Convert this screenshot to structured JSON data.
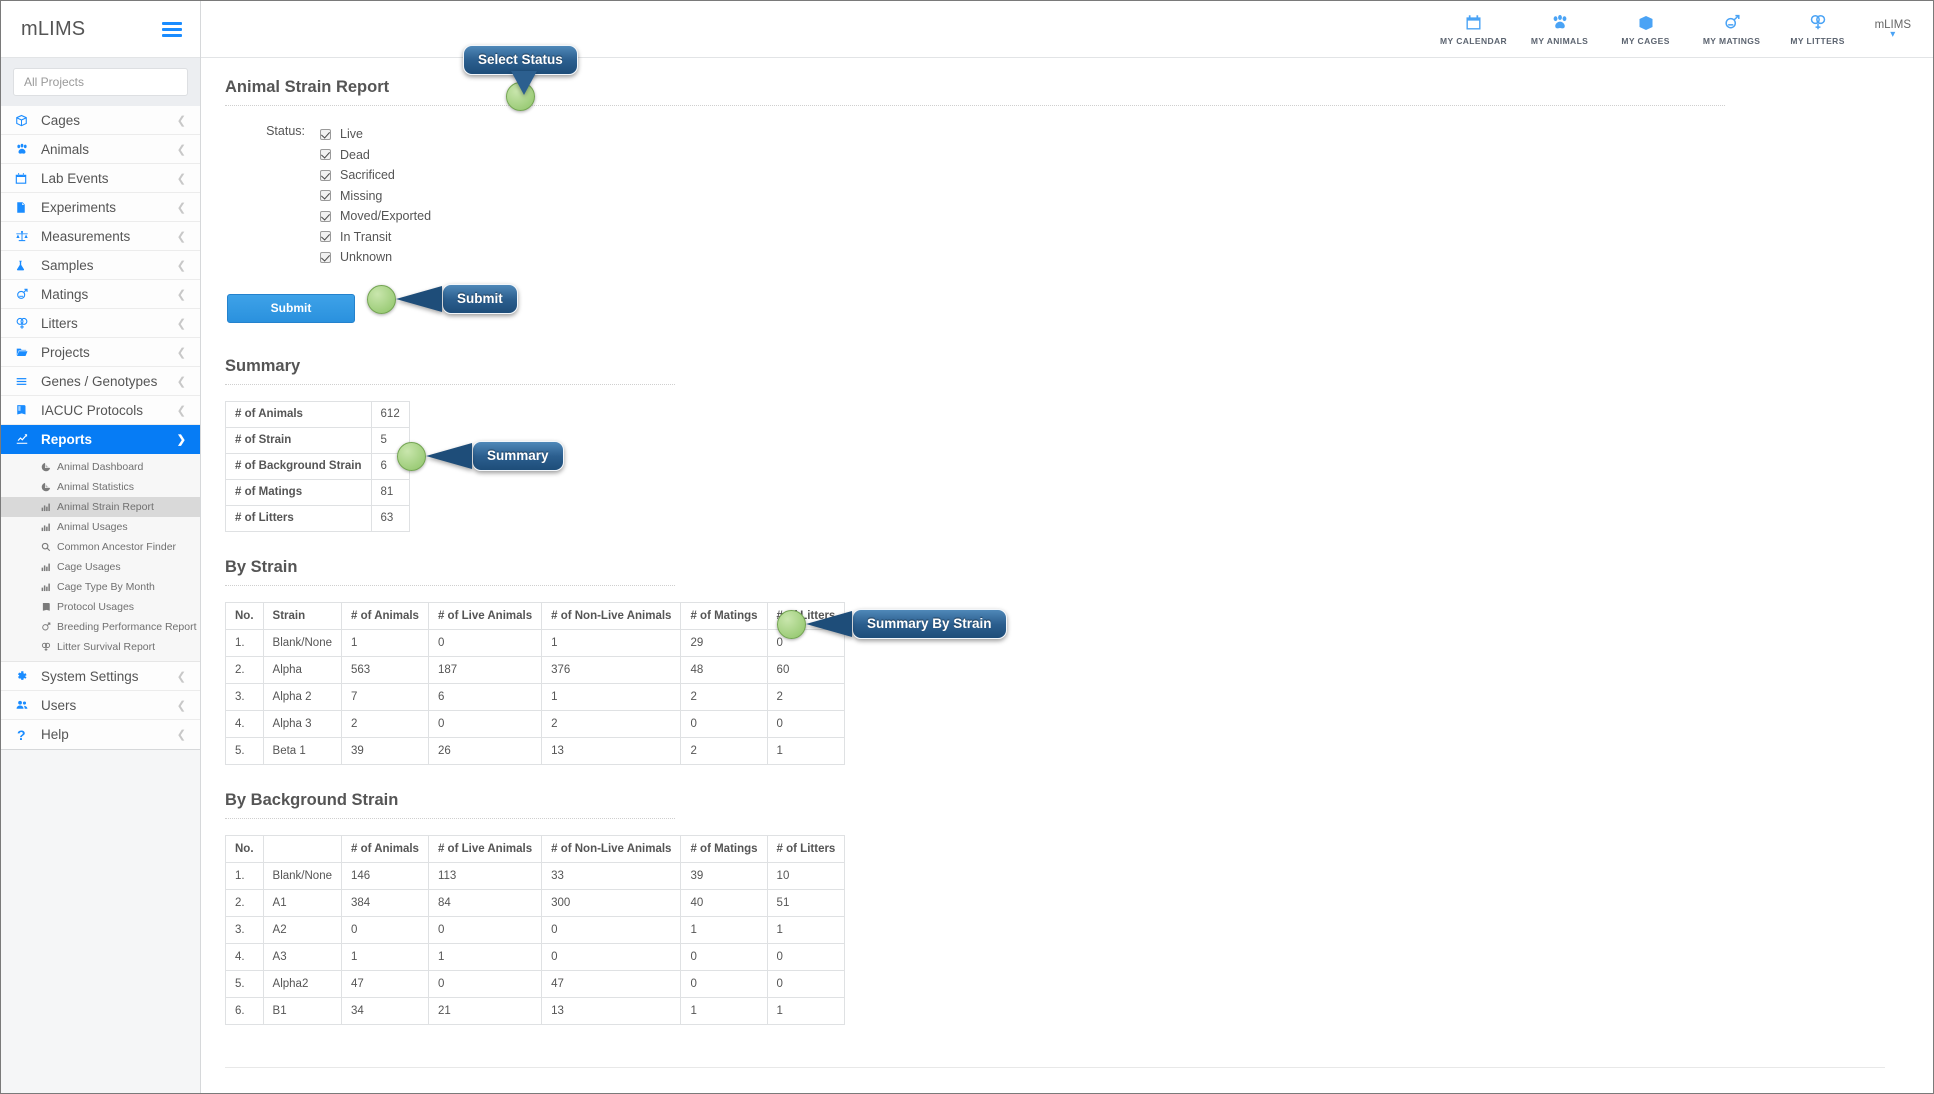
{
  "app": {
    "brand": "mLIMS",
    "menu_icon": "hamburger-icon"
  },
  "sidebar": {
    "project_filter_placeholder": "All Projects",
    "project_filter_value": "",
    "items": [
      {
        "label": "Cages",
        "icon": "box-icon"
      },
      {
        "label": "Animals",
        "icon": "paw-icon"
      },
      {
        "label": "Lab Events",
        "icon": "calendar-icon"
      },
      {
        "label": "Experiments",
        "icon": "flask-doc-icon"
      },
      {
        "label": "Measurements",
        "icon": "scale-icon"
      },
      {
        "label": "Samples",
        "icon": "test-tube-icon"
      },
      {
        "label": "Matings",
        "icon": "mars-venus-icon"
      },
      {
        "label": "Litters",
        "icon": "venus-double-icon"
      },
      {
        "label": "Projects",
        "icon": "folder-open-icon"
      },
      {
        "label": "Genes / Genotypes",
        "icon": "bars-icon"
      },
      {
        "label": "IACUC Protocols",
        "icon": "book-icon"
      },
      {
        "label": "Reports",
        "icon": "chart-line-icon",
        "active": true
      },
      {
        "label": "System Settings",
        "icon": "gear-icon"
      },
      {
        "label": "Users",
        "icon": "users-icon"
      },
      {
        "label": "Help",
        "icon": "question-icon"
      }
    ],
    "reports_submenu": [
      {
        "label": "Animal Dashboard",
        "icon": "pie-chart-icon"
      },
      {
        "label": "Animal Statistics",
        "icon": "pie-chart-icon"
      },
      {
        "label": "Animal Strain Report",
        "icon": "bar-chart-icon",
        "selected": true
      },
      {
        "label": "Animal Usages",
        "icon": "bar-chart-icon"
      },
      {
        "label": "Common Ancestor Finder",
        "icon": "search-icon"
      },
      {
        "label": "Cage Usages",
        "icon": "bar-chart-icon"
      },
      {
        "label": "Cage Type By Month",
        "icon": "bar-chart-icon"
      },
      {
        "label": "Protocol Usages",
        "icon": "book-icon"
      },
      {
        "label": "Breeding Performance Report",
        "icon": "mars-venus-icon"
      },
      {
        "label": "Litter Survival Report",
        "icon": "venus-double-icon"
      }
    ]
  },
  "topnav": {
    "items": [
      {
        "label": "MY CALENDAR",
        "icon": "calendar-icon"
      },
      {
        "label": "MY ANIMALS",
        "icon": "paw-icon"
      },
      {
        "label": "MY CAGES",
        "icon": "box-icon"
      },
      {
        "label": "MY MATINGS",
        "icon": "mars-venus-icon"
      },
      {
        "label": "MY LITTERS",
        "icon": "venus-double-icon"
      }
    ],
    "user": {
      "name": "mLIMS",
      "caret": "chevron-down-icon"
    }
  },
  "page": {
    "title": "Animal Strain Report",
    "status_label": "Status:",
    "status_options": [
      {
        "label": "Live",
        "checked": true
      },
      {
        "label": "Dead",
        "checked": true
      },
      {
        "label": "Sacrificed",
        "checked": true
      },
      {
        "label": "Missing",
        "checked": true
      },
      {
        "label": "Moved/Exported",
        "checked": true
      },
      {
        "label": "In Transit",
        "checked": true
      },
      {
        "label": "Unknown",
        "checked": true
      }
    ],
    "submit_label": "Submit"
  },
  "summary": {
    "title": "Summary",
    "rows": [
      {
        "label": "# of Animals",
        "value": "612",
        "link": true
      },
      {
        "label": "# of Strain",
        "value": "5",
        "link": false
      },
      {
        "label": "# of Background Strain",
        "value": "6",
        "link": false
      },
      {
        "label": "# of Matings",
        "value": "81",
        "link": true
      },
      {
        "label": "# of Litters",
        "value": "63",
        "link": true
      }
    ]
  },
  "by_strain": {
    "title": "By Strain",
    "columns": [
      "No.",
      "Strain",
      "# of Animals",
      "# of Live Animals",
      "# of Non-Live Animals",
      "# of Matings",
      "# of Litters"
    ],
    "rows": [
      {
        "no": "1.",
        "name": "Blank/None",
        "animals": "1",
        "live": "0",
        "nonlive": "1",
        "matings": "29",
        "litters": "0"
      },
      {
        "no": "2.",
        "name": "Alpha",
        "animals": "563",
        "live": "187",
        "nonlive": "376",
        "matings": "48",
        "litters": "60"
      },
      {
        "no": "3.",
        "name": "Alpha 2",
        "animals": "7",
        "live": "6",
        "nonlive": "1",
        "matings": "2",
        "litters": "2"
      },
      {
        "no": "4.",
        "name": "Alpha 3",
        "animals": "2",
        "live": "0",
        "nonlive": "2",
        "matings": "0",
        "litters": "0"
      },
      {
        "no": "5.",
        "name": "Beta 1",
        "animals": "39",
        "live": "26",
        "nonlive": "13",
        "matings": "2",
        "litters": "1"
      }
    ]
  },
  "by_background_strain": {
    "title": "By Background Strain",
    "columns": [
      "No.",
      "",
      "# of Animals",
      "# of Live Animals",
      "# of Non-Live Animals",
      "# of Matings",
      "# of Litters"
    ],
    "rows": [
      {
        "no": "1.",
        "name": "Blank/None",
        "animals": "146",
        "live": "113",
        "nonlive": "33",
        "matings": "39",
        "litters": "10"
      },
      {
        "no": "2.",
        "name": "A1",
        "animals": "384",
        "live": "84",
        "nonlive": "300",
        "matings": "40",
        "litters": "51"
      },
      {
        "no": "3.",
        "name": "A2",
        "animals": "0",
        "live": "0",
        "nonlive": "0",
        "matings": "1",
        "litters": "1"
      },
      {
        "no": "4.",
        "name": "A3",
        "animals": "1",
        "live": "1",
        "nonlive": "0",
        "matings": "0",
        "litters": "0"
      },
      {
        "no": "5.",
        "name": "Alpha2",
        "animals": "47",
        "live": "0",
        "nonlive": "47",
        "matings": "0",
        "litters": "0"
      },
      {
        "no": "6.",
        "name": "B1",
        "animals": "34",
        "live": "21",
        "nonlive": "13",
        "matings": "1",
        "litters": "1"
      }
    ]
  },
  "callouts": {
    "select_status": "Select Status",
    "submit": "Submit",
    "summary": "Summary",
    "summary_by_strain": "Summary By Strain"
  },
  "colors": {
    "accent": "#067cf5",
    "link": "#2a7ade",
    "button": "#2a91de",
    "callout_dot": "#9ccc78",
    "callout_bubble": "#2c5f8f"
  }
}
